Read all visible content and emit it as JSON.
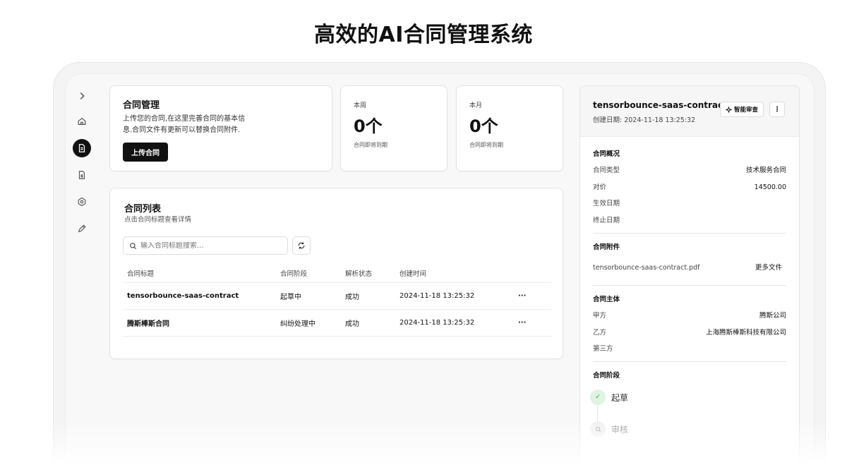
{
  "page": {
    "headline": "高效的AI合同管理系统"
  },
  "sidebar": {
    "items": [
      {
        "name": "expand",
        "icon": "chevron-right-icon"
      },
      {
        "name": "home",
        "icon": "home-icon"
      },
      {
        "name": "contracts",
        "icon": "document-icon",
        "active": true
      },
      {
        "name": "spreadsheet",
        "icon": "spreadsheet-icon"
      },
      {
        "name": "settings",
        "icon": "gear-icon"
      },
      {
        "name": "edit",
        "icon": "pencil-icon"
      }
    ]
  },
  "intro": {
    "title": "合同管理",
    "desc_line1": "上传您的合同,在这里完善合同的基本信",
    "desc_line2": "息.合同文件有更新可以替换合同附件.",
    "upload_label": "上传合同"
  },
  "stats": [
    {
      "label": "本周",
      "value": "0个",
      "sub": "合同即将到期"
    },
    {
      "label": "本月",
      "value": "0个",
      "sub": "合同即将到期"
    }
  ],
  "list": {
    "title": "合同列表",
    "subtitle": "点击合同标题查看详情",
    "search_placeholder": "输入合同标题搜索...",
    "columns": [
      "合同标题",
      "合同阶段",
      "解析状态",
      "创建时间",
      ""
    ],
    "rows": [
      {
        "title": "tensorbounce-saas-contract",
        "stage": "起草中",
        "status": "成功",
        "created": "2024-11-18 13:25:32",
        "more": "···"
      },
      {
        "title": "腾斯棒斯合同",
        "stage": "纠纷处理中",
        "status": "成功",
        "created": "2024-11-18 13:25:32",
        "more": "···"
      }
    ]
  },
  "detail": {
    "title": "tensorbounce-saas-contract",
    "created": "创建日期: 2024-11-18 13:25:32",
    "ai_review_label": "智能审查",
    "more_label": "⋮",
    "overview": {
      "title": "合同概况",
      "rows": [
        {
          "label": "合同类型",
          "value": "技术服务合同"
        },
        {
          "label": "对价",
          "value": "14500.00"
        },
        {
          "label": "生效日期",
          "value": ""
        },
        {
          "label": "终止日期",
          "value": ""
        }
      ]
    },
    "attachments": {
      "title": "合同附件",
      "file": "tensorbounce-saas-contract.pdf",
      "more_files": "更多文件"
    },
    "parties": {
      "title": "合同主体",
      "rows": [
        {
          "label": "甲方",
          "value": "腾斯公司"
        },
        {
          "label": "乙方",
          "value": "上海腾斯棒斯科技有限公司"
        },
        {
          "label": "第三方",
          "value": ""
        }
      ]
    },
    "stages": {
      "title": "合同阶段",
      "items": [
        {
          "label": "起草",
          "state": "done"
        },
        {
          "label": "审核",
          "state": "todo"
        }
      ]
    }
  },
  "colors": {
    "accent": "#111111",
    "success": "#3c9a4e",
    "success_bg": "#dff3e3"
  }
}
